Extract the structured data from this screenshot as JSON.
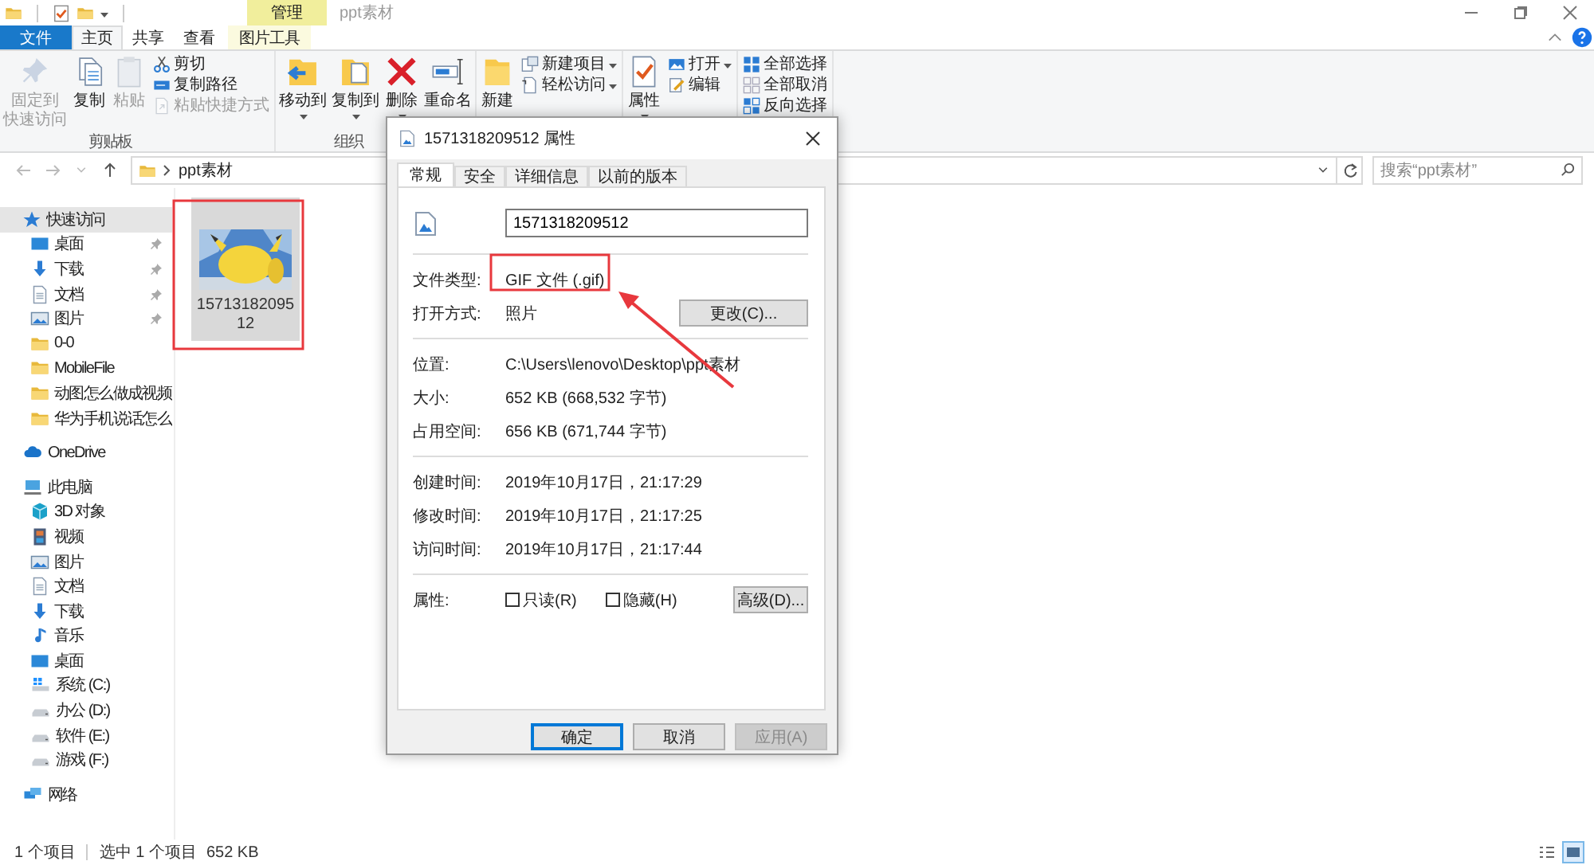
{
  "window": {
    "title": "ppt素材",
    "contextual_tab": "管理"
  },
  "ribbon_tabs": [
    {
      "label": "文件",
      "kind": "file",
      "selected": false
    },
    {
      "label": "主页",
      "kind": "normal",
      "selected": true
    },
    {
      "label": "共享",
      "kind": "normal",
      "selected": false
    },
    {
      "label": "查看",
      "kind": "normal",
      "selected": false
    },
    {
      "label": "图片工具",
      "kind": "contextual",
      "selected": false
    }
  ],
  "ribbon_groups": [
    {
      "label": "剪贴板",
      "items": [
        {
          "kind": "large",
          "lines": [
            "固定到",
            "快速访问"
          ],
          "disabled": true,
          "caret": false
        },
        {
          "kind": "large",
          "label": "复制",
          "disabled": false,
          "caret": false
        },
        {
          "kind": "large",
          "label": "粘贴",
          "disabled": true,
          "caret": false
        },
        {
          "kind": "small",
          "label": "剪切",
          "disabled": false,
          "caret": false
        },
        {
          "kind": "small",
          "label": "复制路径",
          "disabled": false,
          "caret": false
        },
        {
          "kind": "small",
          "label": "粘贴快捷方式",
          "disabled": true,
          "caret": false
        }
      ]
    },
    {
      "label": "组织",
      "items": [
        {
          "kind": "large",
          "label": "移动到",
          "disabled": false,
          "caret": true
        },
        {
          "kind": "large",
          "label": "复制到",
          "disabled": false,
          "caret": true
        },
        {
          "kind": "large",
          "label": "删除",
          "disabled": false,
          "caret": true
        },
        {
          "kind": "large",
          "label": "重命名",
          "disabled": false,
          "caret": false
        }
      ]
    },
    {
      "items": [
        {
          "kind": "large",
          "label": "新建",
          "disabled": false,
          "caret": false
        },
        {
          "kind": "small",
          "label": "新建项目",
          "disabled": false,
          "caret": true
        },
        {
          "kind": "small",
          "label": "轻松访问",
          "disabled": false,
          "caret": true
        }
      ]
    },
    {
      "items": [
        {
          "kind": "large",
          "label": "属性",
          "disabled": false,
          "caret": true
        },
        {
          "kind": "small",
          "label": "打开",
          "disabled": false,
          "caret": true
        },
        {
          "kind": "small",
          "label": "编辑",
          "disabled": false,
          "caret": false
        }
      ]
    },
    {
      "items": [
        {
          "kind": "small",
          "label": "全部选择",
          "disabled": false,
          "caret": false
        },
        {
          "kind": "small",
          "label": "全部取消",
          "disabled": false,
          "caret": false
        },
        {
          "kind": "small",
          "label": "反向选择",
          "disabled": false,
          "caret": false
        }
      ]
    }
  ],
  "address_bar": {
    "path": "ppt素材"
  },
  "search": {
    "placeholder": "搜索“ppt素材”"
  },
  "sidebar": {
    "sections": [
      [
        {
          "label": "快速访问",
          "kind": "star",
          "selected": true,
          "pinned": false,
          "children": [
            {
              "label": "桌面",
              "kind": "desktop",
              "selected": false,
              "pinned": true
            },
            {
              "label": "下载",
              "kind": "download",
              "selected": false,
              "pinned": true
            },
            {
              "label": "文档",
              "kind": "document",
              "selected": false,
              "pinned": true
            },
            {
              "label": "图片",
              "kind": "pictures",
              "selected": false,
              "pinned": true
            },
            {
              "label": "0-0",
              "kind": "folder",
              "selected": false,
              "pinned": false
            },
            {
              "label": "MobileFile",
              "kind": "folder",
              "selected": false,
              "pinned": false
            },
            {
              "label": "动图怎么做成视频",
              "kind": "folder",
              "selected": false,
              "pinned": false
            },
            {
              "label": "华为手机说话怎么",
              "kind": "folder",
              "selected": false,
              "pinned": false
            }
          ]
        }
      ],
      [
        {
          "label": "OneDrive",
          "kind": "cloud",
          "selected": false,
          "pinned": false
        }
      ],
      [
        {
          "label": "此电脑",
          "kind": "pc",
          "selected": false,
          "pinned": false,
          "children": [
            {
              "label": "3D 对象",
              "kind": "cube",
              "selected": false,
              "pinned": false
            },
            {
              "label": "视频",
              "kind": "video",
              "selected": false,
              "pinned": false
            },
            {
              "label": "图片",
              "kind": "pictures",
              "selected": false,
              "pinned": false
            },
            {
              "label": "文档",
              "kind": "document",
              "selected": false,
              "pinned": false
            },
            {
              "label": "下载",
              "kind": "download",
              "selected": false,
              "pinned": false
            },
            {
              "label": "音乐",
              "kind": "music",
              "selected": false,
              "pinned": false
            },
            {
              "label": "桌面",
              "kind": "desktop",
              "selected": false,
              "pinned": false
            },
            {
              "label": "系统 (C:)",
              "kind": "system-drive",
              "selected": false,
              "pinned": false
            },
            {
              "label": "办公 (D:)",
              "kind": "drive",
              "selected": false,
              "pinned": false
            },
            {
              "label": "软件 (E:)",
              "kind": "drive",
              "selected": false,
              "pinned": false
            },
            {
              "label": "游戏 (F:)",
              "kind": "drive",
              "selected": false,
              "pinned": false
            }
          ]
        }
      ],
      [
        {
          "label": "网络",
          "kind": "network",
          "selected": false,
          "pinned": false
        }
      ]
    ]
  },
  "files": [
    {
      "name": "1571318209512",
      "kind": "picture",
      "selected": true
    }
  ],
  "status_bar": {
    "count": "1 个项目",
    "selection": "选中 1 个项目",
    "size": "652 KB"
  },
  "views": [
    {
      "selected": false
    },
    {
      "selected": true
    }
  ],
  "dialog": {
    "title": "1571318209512 属性",
    "tabs": [
      {
        "label": "常规",
        "selected": true
      },
      {
        "label": "安全",
        "selected": false
      },
      {
        "label": "详细信息",
        "selected": false
      },
      {
        "label": "以前的版本",
        "selected": false
      }
    ],
    "name_field": {
      "value": "1571318209512"
    },
    "sections": [
      [
        {
          "label": "文件类型:",
          "value": "GIF 文件 (.gif)"
        },
        {
          "label": "打开方式:",
          "value": "照片",
          "button": "更改(C)..."
        }
      ],
      [
        {
          "label": "位置:",
          "value": "C:\\Users\\lenovo\\Desktop\\ppt素材"
        },
        {
          "label": "大小:",
          "value": "652 KB (668,532 字节)"
        },
        {
          "label": "占用空间:",
          "value": "656 KB (671,744 字节)"
        }
      ],
      [
        {
          "label": "创建时间:",
          "value": "2019年10月17日，21:17:29"
        },
        {
          "label": "修改时间:",
          "value": "2019年10月17日，21:17:25"
        },
        {
          "label": "访问时间:",
          "value": "2019年10月17日，21:17:44"
        }
      ]
    ],
    "attributes": {
      "label": "属性:",
      "checkboxes": [
        {
          "label": "只读(R)",
          "checked": false
        },
        {
          "label": "隐藏(H)",
          "checked": false
        }
      ],
      "button": "高级(D)..."
    },
    "buttons": [
      {
        "label": "确定",
        "kind": "default",
        "disabled": false
      },
      {
        "label": "取消",
        "kind": "normal",
        "disabled": false
      },
      {
        "label": "应用(A)",
        "kind": "normal",
        "disabled": true
      }
    ]
  }
}
